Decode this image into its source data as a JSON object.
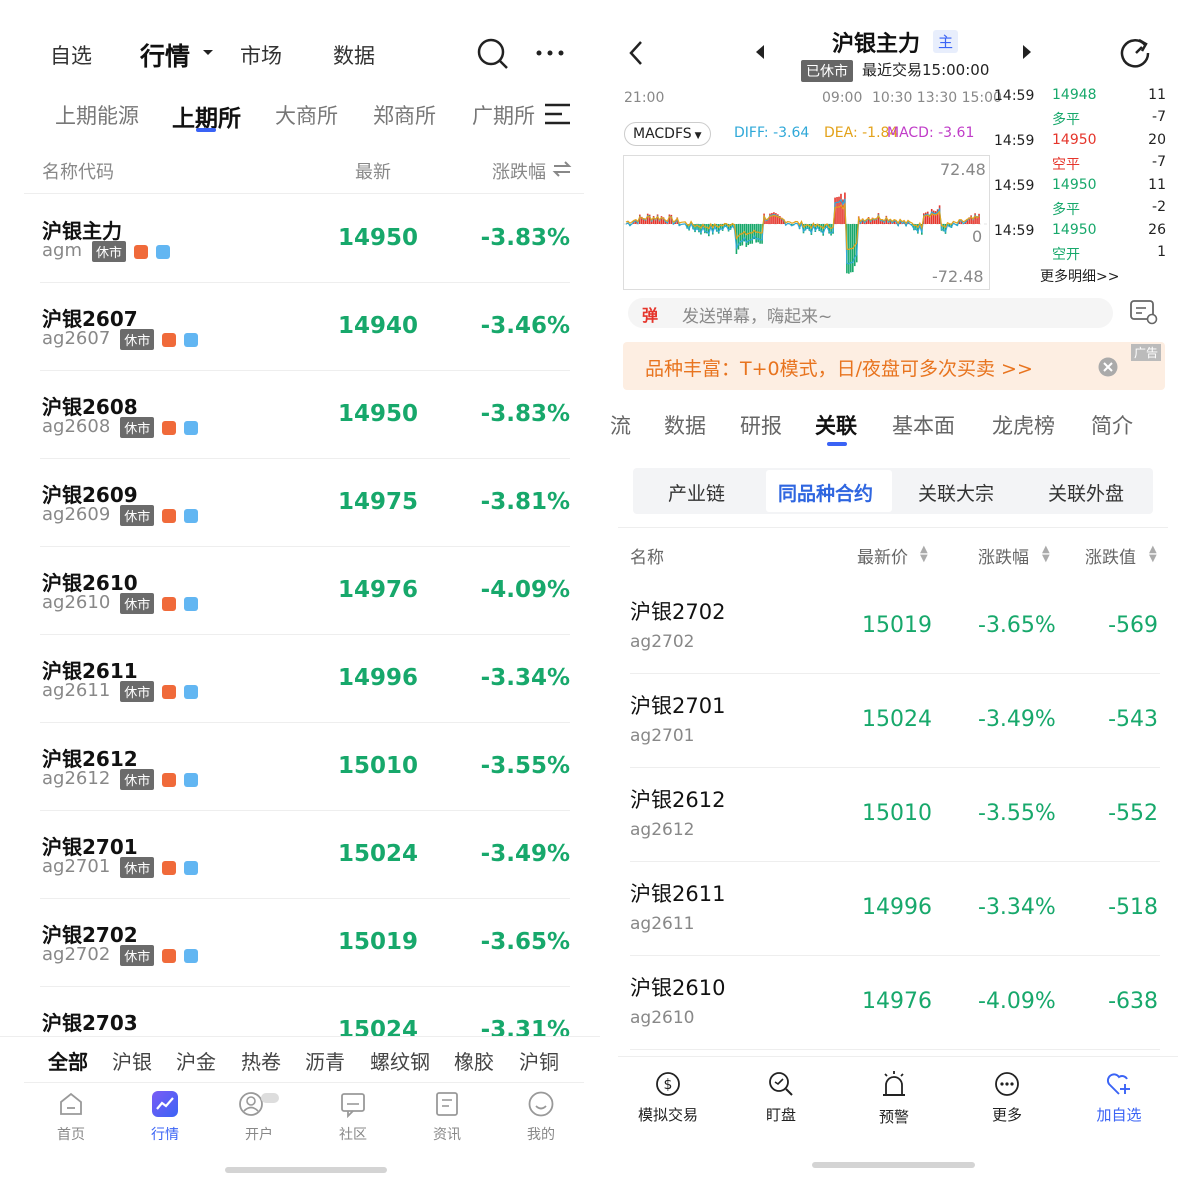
{
  "left": {
    "top_nav": [
      "自选",
      "行情",
      "市场",
      "数据"
    ],
    "exchange_tabs": [
      "上期能源",
      "上期所",
      "大商所",
      "郑商所",
      "广期所"
    ],
    "headers": {
      "name": "名称代码",
      "latest": "最新",
      "change": "涨跌幅"
    },
    "rows": [
      {
        "name": "沪银主力",
        "code": "agm",
        "tag": "休市",
        "price": "14950",
        "pct": "-3.83%"
      },
      {
        "name": "沪银2607",
        "code": "ag2607",
        "tag": "休市",
        "price": "14940",
        "pct": "-3.46%"
      },
      {
        "name": "沪银2608",
        "code": "ag2608",
        "tag": "休市",
        "price": "14950",
        "pct": "-3.83%"
      },
      {
        "name": "沪银2609",
        "code": "ag2609",
        "tag": "休市",
        "price": "14975",
        "pct": "-3.81%"
      },
      {
        "name": "沪银2610",
        "code": "ag2610",
        "tag": "休市",
        "price": "14976",
        "pct": "-4.09%"
      },
      {
        "name": "沪银2611",
        "code": "ag2611",
        "tag": "休市",
        "price": "14996",
        "pct": "-3.34%"
      },
      {
        "name": "沪银2612",
        "code": "ag2612",
        "tag": "休市",
        "price": "15010",
        "pct": "-3.55%"
      },
      {
        "name": "沪银2701",
        "code": "ag2701",
        "tag": "休市",
        "price": "15024",
        "pct": "-3.49%"
      },
      {
        "name": "沪银2702",
        "code": "ag2702",
        "tag": "休市",
        "price": "15019",
        "pct": "-3.65%"
      },
      {
        "name": "沪银2703",
        "code": "",
        "tag": "",
        "price": "15024",
        "pct": "-3.31%"
      }
    ],
    "category_tabs": [
      "全部",
      "沪银",
      "沪金",
      "热卷",
      "沥青",
      "螺纹钢",
      "橡胶",
      "沪铜"
    ],
    "bottom_nav": [
      "首页",
      "行情",
      "开户",
      "社区",
      "资讯",
      "我的"
    ]
  },
  "right": {
    "title": "沪银主力",
    "main_badge": "主",
    "status_badge": "已休市",
    "last_trade": "最近交易15:00:00",
    "time_axis": [
      "21:00",
      "09:00",
      "10:30 13:30 15:00"
    ],
    "indicator": "MACDFS",
    "diff_label": "DIFF: -3.64",
    "dea_label": "DEA: -1.84",
    "macd_label": "MACD: -3.61",
    "axis_top": "72.48",
    "axis_zero": "0",
    "axis_bottom": "-72.48",
    "ticks": [
      {
        "time": "14:59",
        "price": "14948",
        "type": "多平",
        "vol": "11",
        "vol2": "-7",
        "price_color": "#17a86b",
        "type_color": "#17a86b"
      },
      {
        "time": "14:59",
        "price": "14950",
        "type": "空平",
        "vol": "20",
        "vol2": "-7",
        "price_color": "#e5352b",
        "type_color": "#e5352b"
      },
      {
        "time": "14:59",
        "price": "14950",
        "type": "多平",
        "vol": "11",
        "vol2": "-2",
        "price_color": "#17a86b",
        "type_color": "#17a86b"
      },
      {
        "time": "14:59",
        "price": "14950",
        "type": "空开",
        "vol": "26",
        "vol2": "1",
        "price_color": "#17a86b",
        "type_color": "#17a86b"
      }
    ],
    "more_detail": "更多明细>>",
    "danmu_placeholder": "发送弹幕，嗨起来~",
    "danmu_badge": "弹",
    "ad_text": "品种丰富：T+0模式，日/夜盘可多次买卖 >>",
    "ad_tag": "广告",
    "tabs": [
      "流",
      "数据",
      "研报",
      "关联",
      "基本面",
      "龙虎榜",
      "简介"
    ],
    "sub_tabs": [
      "产业链",
      "同品种合约",
      "关联大宗",
      "关联外盘"
    ],
    "table_headers": {
      "name": "名称",
      "price": "最新价",
      "pct": "涨跌幅",
      "chg": "涨跌值"
    },
    "rows": [
      {
        "name": "沪银2702",
        "code": "ag2702",
        "price": "15019",
        "pct": "-3.65%",
        "chg": "-569"
      },
      {
        "name": "沪银2701",
        "code": "ag2701",
        "price": "15024",
        "pct": "-3.49%",
        "chg": "-543"
      },
      {
        "name": "沪银2612",
        "code": "ag2612",
        "price": "15010",
        "pct": "-3.55%",
        "chg": "-552"
      },
      {
        "name": "沪银2611",
        "code": "ag2611",
        "price": "14996",
        "pct": "-3.34%",
        "chg": "-518"
      },
      {
        "name": "沪银2610",
        "code": "ag2610",
        "price": "14976",
        "pct": "-4.09%",
        "chg": "-638"
      }
    ],
    "actions": [
      "模拟交易",
      "盯盘",
      "预警",
      "更多",
      "加自选"
    ]
  },
  "colors": {
    "up": "#e5352b",
    "down": "#17a86b",
    "accent": "#3a63f5",
    "diff": "#2fa8d8",
    "dea": "#e3a21a",
    "macd": "#c03cc8"
  }
}
